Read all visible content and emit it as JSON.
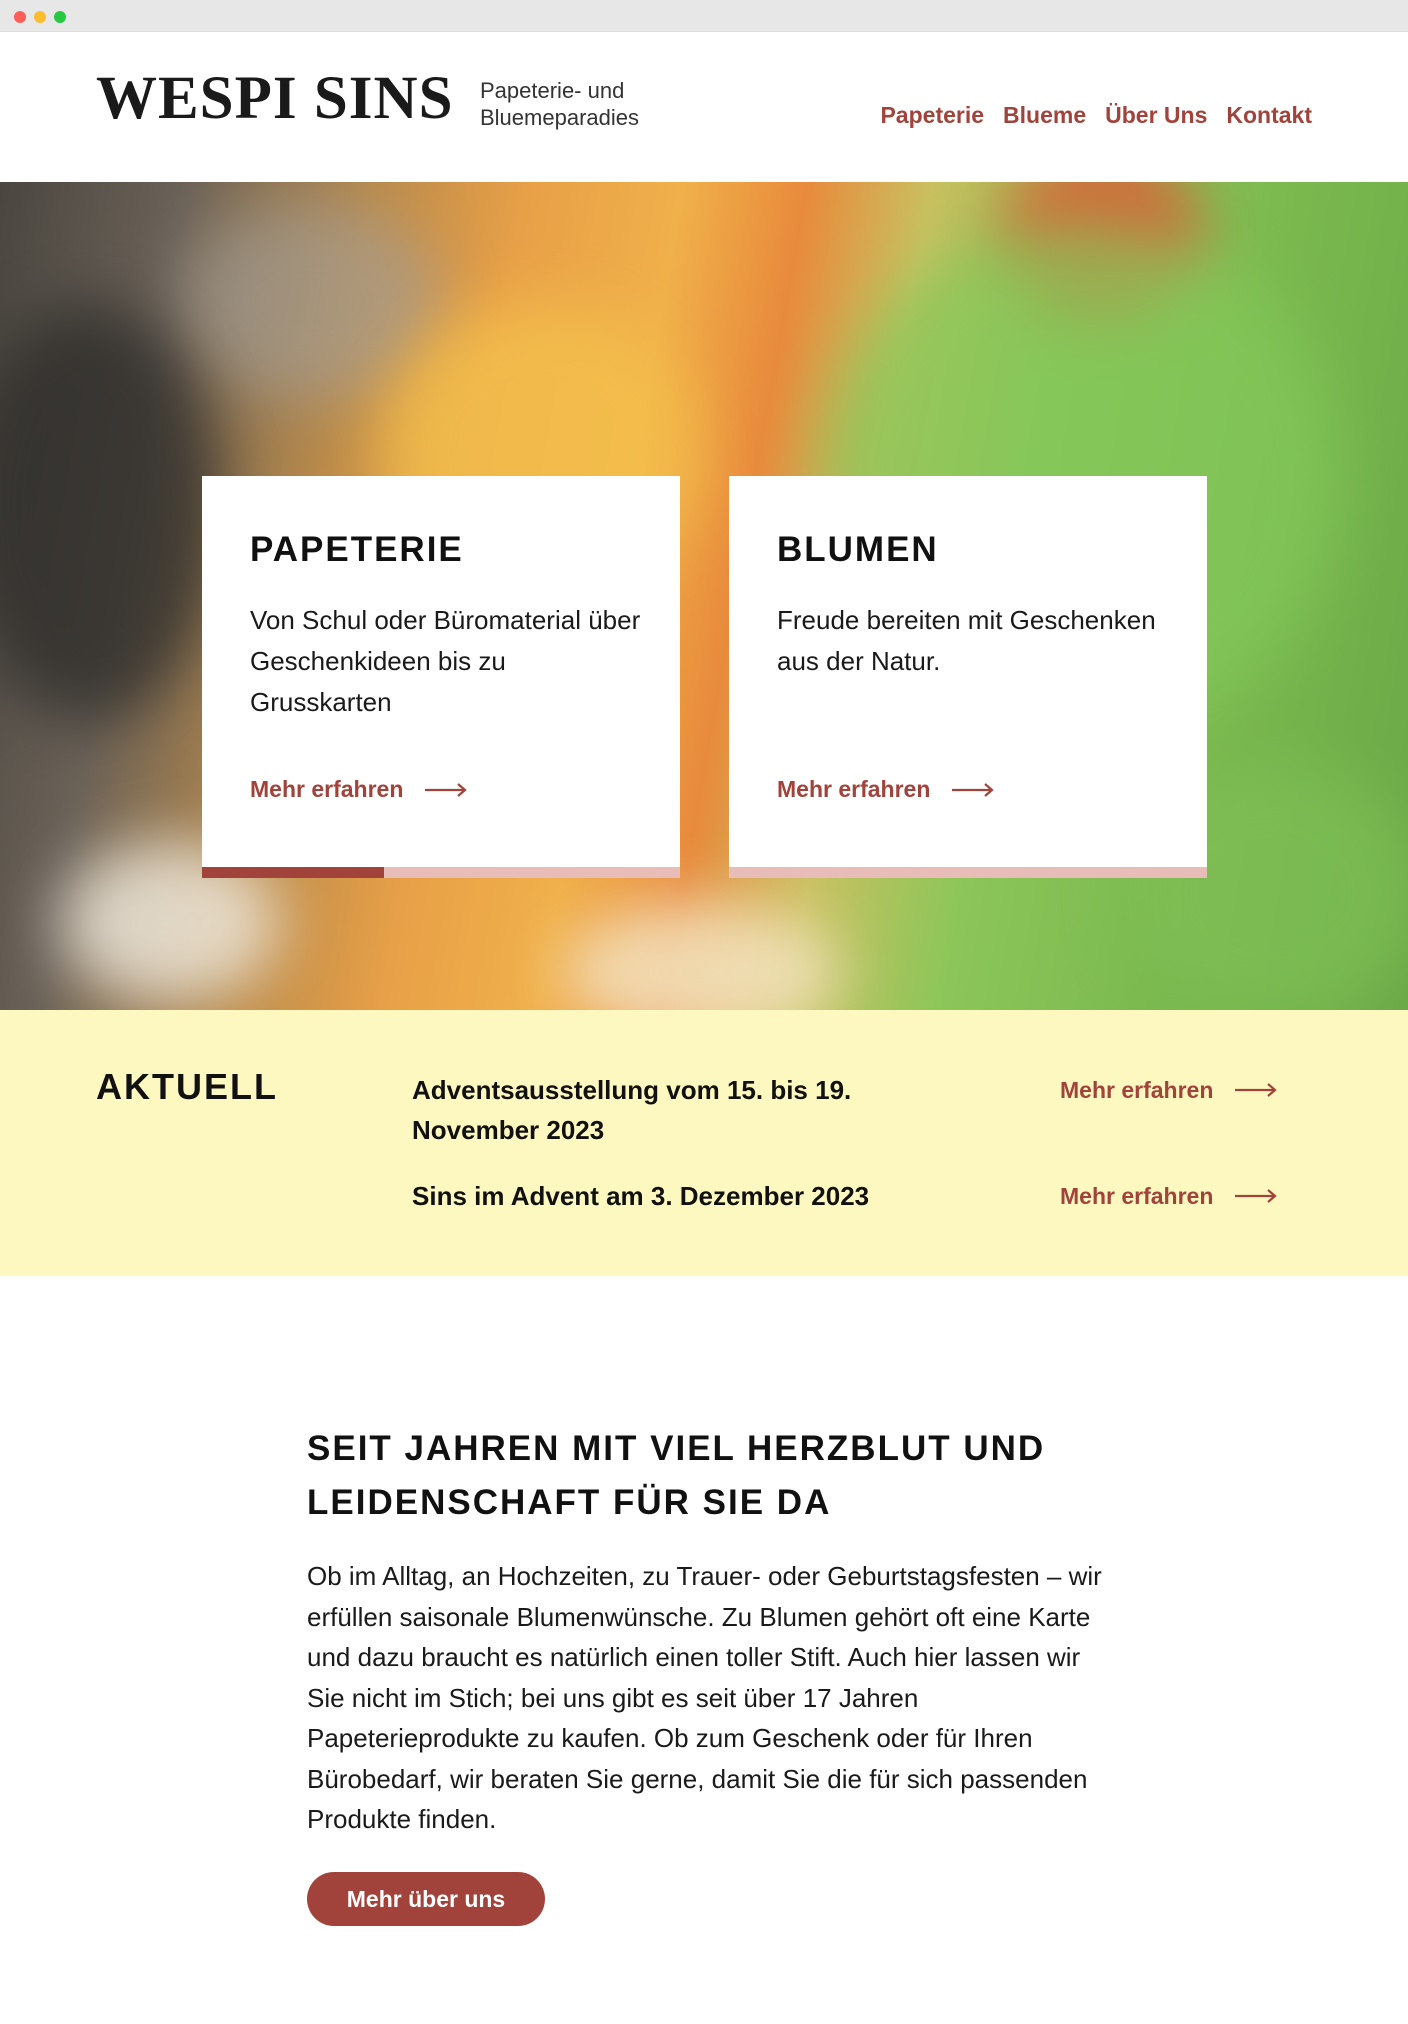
{
  "header": {
    "logo": "WESPI SINS",
    "tagline_line1": "Papeterie- und",
    "tagline_line2": "Bluemeparadies",
    "nav": [
      {
        "label": "Papeterie"
      },
      {
        "label": "Blueme"
      },
      {
        "label": "Über Uns"
      },
      {
        "label": "Kontakt"
      }
    ]
  },
  "hero": {
    "cards": [
      {
        "title": "PAPETERIE",
        "text": "Von Schul oder Büromaterial über Geschenkideen bis zu Grusskarten",
        "link": "Mehr erfahren"
      },
      {
        "title": "BLUMEN",
        "text": "Freude bereiten mit Geschenken aus der Natur.",
        "link": "Mehr erfahren"
      }
    ],
    "slider_progress_percent": 38
  },
  "aktuell": {
    "heading": "AKTUELL",
    "items": [
      {
        "title": "Adventsausstellung vom 15. bis 19. November 2023",
        "link": "Mehr erfahren"
      },
      {
        "title": "Sins im Advent am 3. Dezember 2023",
        "link": "Mehr erfahren"
      }
    ]
  },
  "about": {
    "heading": "SEIT JAHREN MIT VIEL HERZBLUT UND LEIDENSCHAFT FÜR SIE DA",
    "text": "Ob im Alltag, an Hochzeiten, zu Trauer- oder Geburtstagsfesten – wir erfüllen saisonale Blumenwünsche. Zu Blumen gehört oft eine Karte und dazu braucht es natürlich einen toller Stift. Auch hier lassen wir Sie nicht im Stich; bei uns gibt es seit über 17 Jahren Papeterieprodukte zu kaufen. Ob zum Geschenk oder für Ihren Bürobedarf, wir beraten Sie gerne, damit Sie die für sich passenden Produkte finden.",
    "button": "Mehr über uns"
  },
  "colors": {
    "accent": "#a2433b",
    "accent_light": "#e8bdb8",
    "news_bg": "#fdf8c0"
  },
  "icons": {
    "arrow": "arrow-right-icon"
  }
}
